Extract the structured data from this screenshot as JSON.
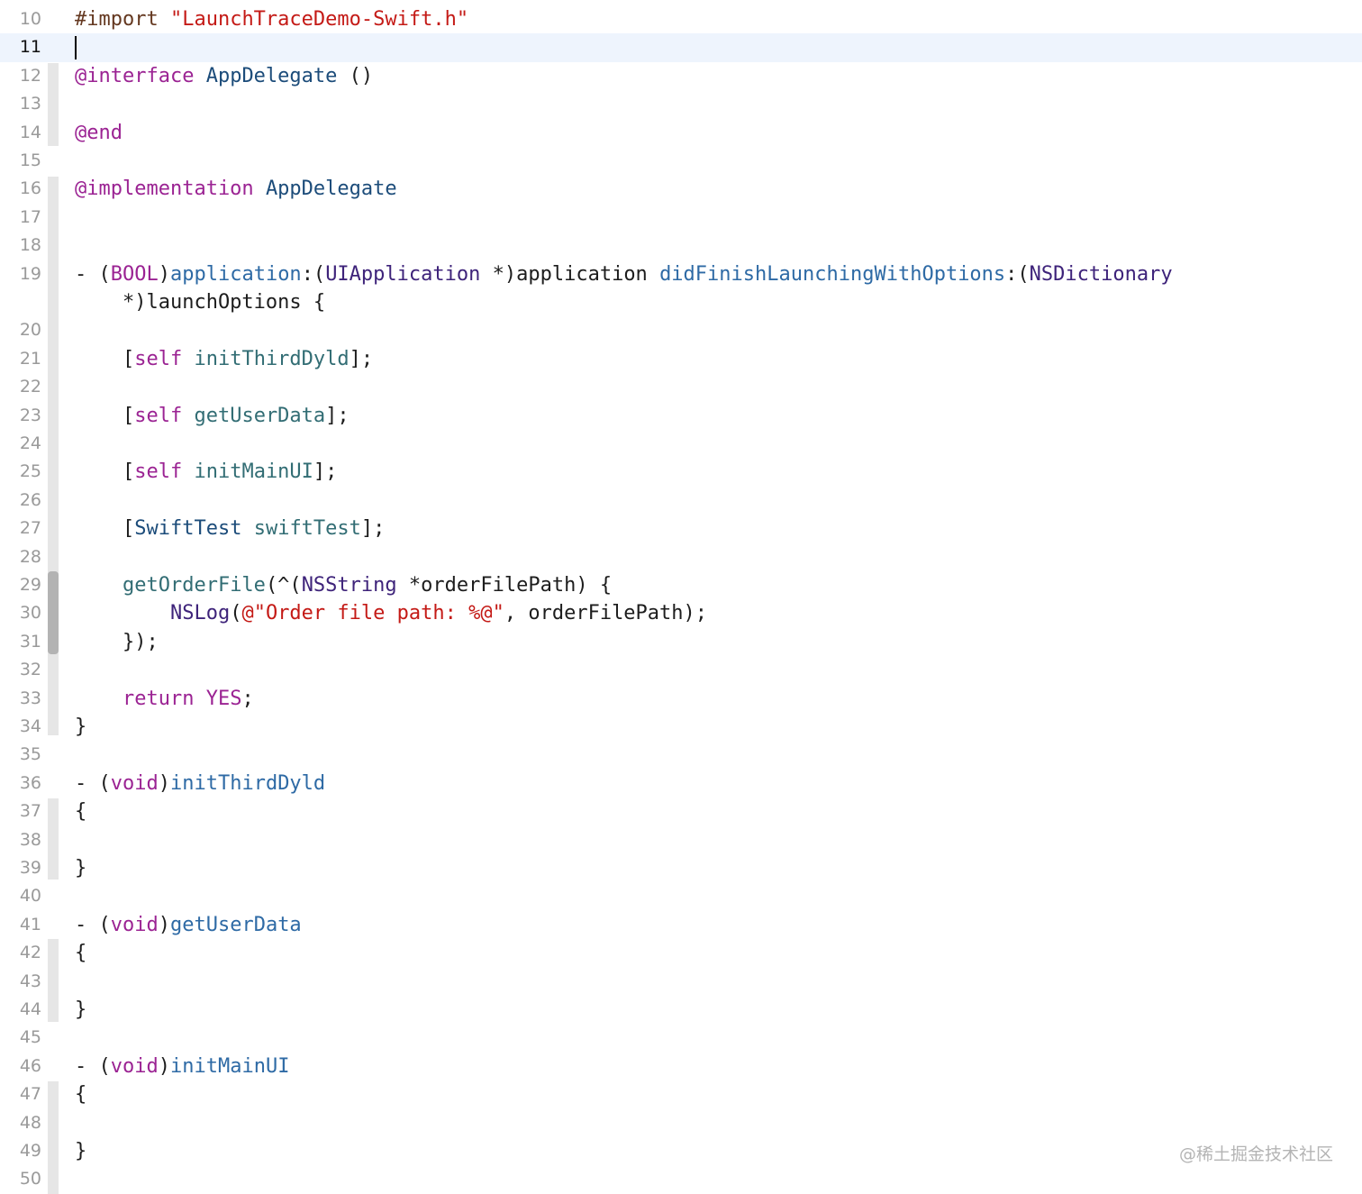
{
  "editor": {
    "current_line": "11",
    "lines": [
      {
        "n": "10",
        "tokens": [
          {
            "t": "#import ",
            "c": "pre"
          },
          {
            "t": "\"LaunchTraceDemo-Swift.h\"",
            "c": "str"
          }
        ]
      },
      {
        "n": "11",
        "tokens": []
      },
      {
        "n": "12",
        "tokens": [
          {
            "t": "@interface",
            "c": "kw"
          },
          {
            "t": " "
          },
          {
            "t": "AppDelegate",
            "c": "cls"
          },
          {
            "t": " ()"
          }
        ]
      },
      {
        "n": "13",
        "tokens": []
      },
      {
        "n": "14",
        "tokens": [
          {
            "t": "@end",
            "c": "kw"
          }
        ]
      },
      {
        "n": "15",
        "tokens": []
      },
      {
        "n": "16",
        "tokens": [
          {
            "t": "@implementation",
            "c": "kw"
          },
          {
            "t": " "
          },
          {
            "t": "AppDelegate",
            "c": "cls"
          }
        ]
      },
      {
        "n": "17",
        "tokens": []
      },
      {
        "n": "18",
        "tokens": []
      },
      {
        "n": "19",
        "tokens": [
          {
            "t": "- ("
          },
          {
            "t": "BOOL",
            "c": "kw"
          },
          {
            "t": ")"
          },
          {
            "t": "application",
            "c": "sel"
          },
          {
            "t": ":("
          },
          {
            "t": "UIApplication",
            "c": "typ"
          },
          {
            "t": " *)application "
          },
          {
            "t": "didFinishLaunchingWithOptions",
            "c": "sel"
          },
          {
            "t": ":("
          },
          {
            "t": "NSDictionary",
            "c": "typ"
          }
        ]
      },
      {
        "n": "",
        "tokens": [
          {
            "t": "    *)launchOptions {"
          }
        ]
      },
      {
        "n": "20",
        "tokens": []
      },
      {
        "n": "21",
        "tokens": [
          {
            "t": "    ["
          },
          {
            "t": "self",
            "c": "kw"
          },
          {
            "t": " "
          },
          {
            "t": "initThirdDyld",
            "c": "fn"
          },
          {
            "t": "];"
          }
        ]
      },
      {
        "n": "22",
        "tokens": []
      },
      {
        "n": "23",
        "tokens": [
          {
            "t": "    ["
          },
          {
            "t": "self",
            "c": "kw"
          },
          {
            "t": " "
          },
          {
            "t": "getUserData",
            "c": "fn"
          },
          {
            "t": "];"
          }
        ]
      },
      {
        "n": "24",
        "tokens": []
      },
      {
        "n": "25",
        "tokens": [
          {
            "t": "    ["
          },
          {
            "t": "self",
            "c": "kw"
          },
          {
            "t": " "
          },
          {
            "t": "initMainUI",
            "c": "fn"
          },
          {
            "t": "];"
          }
        ]
      },
      {
        "n": "26",
        "tokens": []
      },
      {
        "n": "27",
        "tokens": [
          {
            "t": "    ["
          },
          {
            "t": "SwiftTest",
            "c": "cls"
          },
          {
            "t": " "
          },
          {
            "t": "swiftTest",
            "c": "fn"
          },
          {
            "t": "];"
          }
        ]
      },
      {
        "n": "28",
        "tokens": []
      },
      {
        "n": "29",
        "tokens": [
          {
            "t": "    "
          },
          {
            "t": "getOrderFile",
            "c": "fn"
          },
          {
            "t": "(^("
          },
          {
            "t": "NSString",
            "c": "typ"
          },
          {
            "t": " *orderFilePath) {"
          }
        ]
      },
      {
        "n": "30",
        "tokens": [
          {
            "t": "        "
          },
          {
            "t": "NSLog",
            "c": "typ"
          },
          {
            "t": "("
          },
          {
            "t": "@\"Order file path: %@\"",
            "c": "str"
          },
          {
            "t": ", orderFilePath);"
          }
        ]
      },
      {
        "n": "31",
        "tokens": [
          {
            "t": "    });"
          }
        ]
      },
      {
        "n": "32",
        "tokens": []
      },
      {
        "n": "33",
        "tokens": [
          {
            "t": "    "
          },
          {
            "t": "return",
            "c": "kw"
          },
          {
            "t": " "
          },
          {
            "t": "YES",
            "c": "kw"
          },
          {
            "t": ";"
          }
        ]
      },
      {
        "n": "34",
        "tokens": [
          {
            "t": "}"
          }
        ]
      },
      {
        "n": "35",
        "tokens": []
      },
      {
        "n": "36",
        "tokens": [
          {
            "t": "- ("
          },
          {
            "t": "void",
            "c": "kw"
          },
          {
            "t": ")"
          },
          {
            "t": "initThirdDyld",
            "c": "sel"
          }
        ]
      },
      {
        "n": "37",
        "tokens": [
          {
            "t": "{"
          }
        ]
      },
      {
        "n": "38",
        "tokens": []
      },
      {
        "n": "39",
        "tokens": [
          {
            "t": "}"
          }
        ]
      },
      {
        "n": "40",
        "tokens": []
      },
      {
        "n": "41",
        "tokens": [
          {
            "t": "- ("
          },
          {
            "t": "void",
            "c": "kw"
          },
          {
            "t": ")"
          },
          {
            "t": "getUserData",
            "c": "sel"
          }
        ]
      },
      {
        "n": "42",
        "tokens": [
          {
            "t": "{"
          }
        ]
      },
      {
        "n": "43",
        "tokens": []
      },
      {
        "n": "44",
        "tokens": [
          {
            "t": "}"
          }
        ]
      },
      {
        "n": "45",
        "tokens": []
      },
      {
        "n": "46",
        "tokens": [
          {
            "t": "- ("
          },
          {
            "t": "void",
            "c": "kw"
          },
          {
            "t": ")"
          },
          {
            "t": "initMainUI",
            "c": "sel"
          }
        ]
      },
      {
        "n": "47",
        "tokens": [
          {
            "t": "{"
          }
        ]
      },
      {
        "n": "48",
        "tokens": []
      },
      {
        "n": "49",
        "tokens": [
          {
            "t": "}"
          }
        ]
      },
      {
        "n": "50",
        "tokens": []
      }
    ]
  },
  "watermark": "@稀土掘金技术社区"
}
